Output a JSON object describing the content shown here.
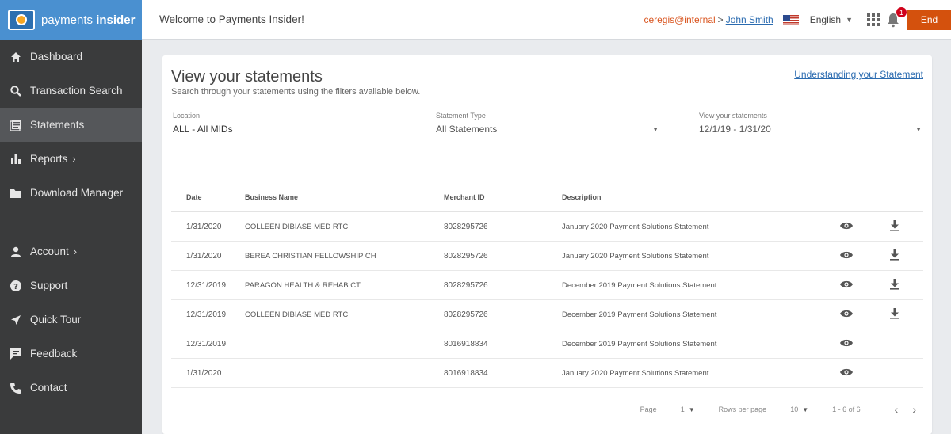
{
  "brand": {
    "logo_text_regular": "payments",
    "logo_text_bold": "insider"
  },
  "sidebar": {
    "items": [
      {
        "label": "Dashboard",
        "icon": "home-icon"
      },
      {
        "label": "Transaction Search",
        "icon": "search-icon"
      },
      {
        "label": "Statements",
        "icon": "statements-icon",
        "active": true
      },
      {
        "label": "Reports",
        "icon": "bar-chart-icon"
      },
      {
        "label": "Download Manager",
        "icon": "folder-icon"
      }
    ],
    "bottom_items": [
      {
        "label": "Account",
        "icon": "person-icon"
      },
      {
        "label": "Support",
        "icon": "help-icon"
      },
      {
        "label": "Quick Tour",
        "icon": "send-icon"
      },
      {
        "label": "Feedback",
        "icon": "feedback-icon"
      },
      {
        "label": "Contact",
        "icon": "phone-icon"
      }
    ]
  },
  "header": {
    "welcome": "Welcome to Payments Insider!",
    "user_internal": "ceregis@internal",
    "separator": ">",
    "user_name": "John Smith",
    "language": "English",
    "notification_count": "1",
    "end_label": "End"
  },
  "main": {
    "title": "View your statements",
    "subtitle": "Search through your statements using the filters available below.",
    "understanding_link": "Understanding your Statement",
    "filters": {
      "location": {
        "label": "Location",
        "value": "ALL - All MIDs"
      },
      "statement_type": {
        "label": "Statement Type",
        "value": "All Statements"
      },
      "date_range": {
        "label": "View your statements",
        "value": "12/1/19 - 1/31/20"
      }
    },
    "table": {
      "headers": {
        "date": "Date",
        "business": "Business Name",
        "merchant_id": "Merchant ID",
        "description": "Description"
      },
      "rows": [
        {
          "date": "1/31/2020",
          "business": "COLLEEN DIBIASE MED RTC",
          "merchant_id": "8028295726",
          "description": "January 2020 Payment Solutions Statement",
          "download": true
        },
        {
          "date": "1/31/2020",
          "business": "BEREA CHRISTIAN FELLOWSHIP CH",
          "merchant_id": "8028295726",
          "description": "January 2020 Payment Solutions Statement",
          "download": true
        },
        {
          "date": "12/31/2019",
          "business": "PARAGON HEALTH & REHAB CT",
          "merchant_id": "8028295726",
          "description": "December 2019 Payment Solutions Statement",
          "download": true
        },
        {
          "date": "12/31/2019",
          "business": "COLLEEN DIBIASE MED RTC",
          "merchant_id": "8028295726",
          "description": "December 2019 Payment Solutions Statement",
          "download": true
        },
        {
          "date": "12/31/2019",
          "business": "",
          "merchant_id": "8016918834",
          "description": "December 2019 Payment Solutions Statement",
          "download": false
        },
        {
          "date": "1/31/2020",
          "business": "",
          "merchant_id": "8016918834",
          "description": "January 2020 Payment Solutions Statement",
          "download": false
        }
      ]
    },
    "pagination": {
      "page_label": "Page",
      "page_value": "1",
      "rows_label": "Rows per page",
      "rows_value": "10",
      "range": "1 - 6 of 6"
    }
  },
  "colors": {
    "sidebar_bg": "#3a3b3c",
    "brand_blue": "#4a90d0",
    "end_orange": "#d4510d",
    "link_blue": "#2a6bb0"
  }
}
